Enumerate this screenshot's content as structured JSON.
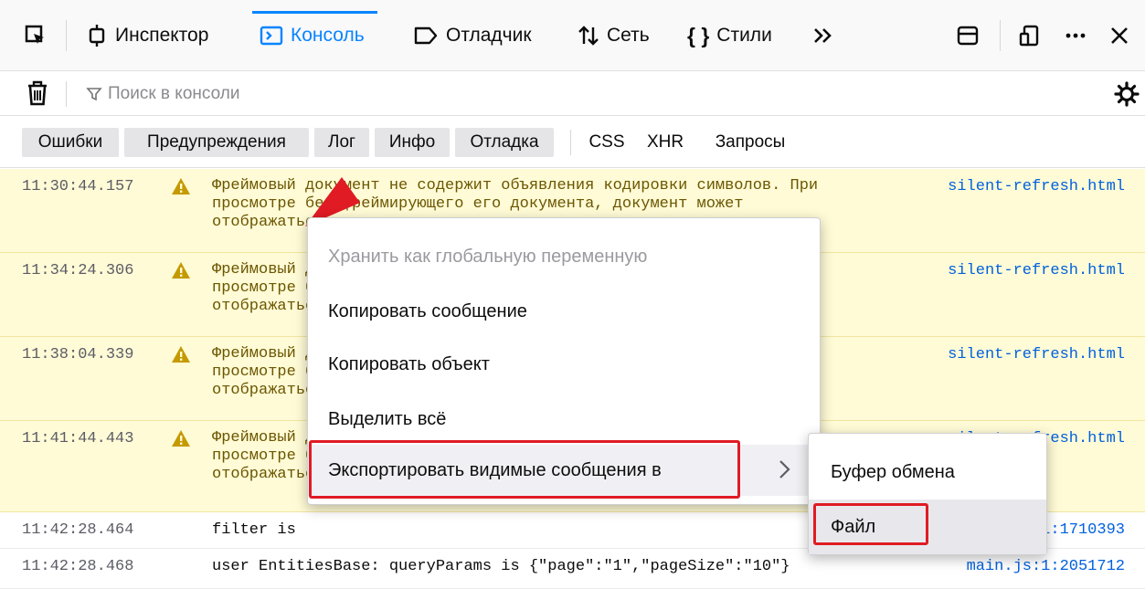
{
  "toolbar": {
    "tabs": [
      {
        "label": "Инспектор",
        "icon": "inspector-icon"
      },
      {
        "label": "Консоль",
        "icon": "console-icon",
        "active": true
      },
      {
        "label": "Отладчик",
        "icon": "debugger-icon"
      },
      {
        "label": "Сеть",
        "icon": "network-icon"
      },
      {
        "label": "Стили",
        "icon": "style-editor-icon"
      }
    ],
    "more_icon": "chevron-double-right-icon",
    "accent_color": "#0a84ff"
  },
  "filter": {
    "placeholder": "Поиск в консоли"
  },
  "levels": {
    "buttons": [
      "Ошибки",
      "Предупреждения",
      "Лог",
      "Инфо",
      "Отладка"
    ],
    "extra": [
      "CSS",
      "XHR",
      "Запросы"
    ]
  },
  "messages": [
    {
      "time": "11:30:44.157",
      "type": "warning",
      "line1": "Фреймовый документ не содержит объявления кодировки символов. При",
      "line2": "просмотре без фреймирующего его документа, документ может",
      "line3": "отображаться по-другому.",
      "source": "silent-refresh.html"
    },
    {
      "time": "11:34:24.306",
      "type": "warning",
      "line1": "Фреймовый документ не содержит объявления кодировки символов. При",
      "line2": "просмотре без фреймирующего его документа, документ может",
      "line3": "отображаться по-другому.",
      "source": "silent-refresh.html"
    },
    {
      "time": "11:38:04.339",
      "type": "warning",
      "line1": "Фреймовый документ не содержит объявления кодировки символов. При",
      "line2": "просмотре без фреймирующего его документа, документ может",
      "line3": "отображаться по-другому.",
      "source": "silent-refresh.html"
    },
    {
      "time": "11:41:44.443",
      "type": "warning",
      "line1": "Фреймовый документ не содержит объявления кодировки символов. При",
      "line2": "просмотре без фреймирующего его документа, документ может",
      "line3": "отображаться по-другому.",
      "source": "silent-refresh.html"
    },
    {
      "time": "11:42:28.464",
      "type": "log",
      "line1": "filter is",
      "source": "main.js:1:1710393"
    },
    {
      "time": "11:42:28.468",
      "type": "log",
      "line1": "user EntitiesBase: queryParams is {\"page\":\"1\",\"pageSize\":\"10\"}",
      "source": "main.js:1:2051712"
    }
  ],
  "context_menu": {
    "items": [
      {
        "label": "Хранить как глобальную переменную",
        "disabled": true
      },
      {
        "label": "Копировать сообщение"
      },
      {
        "label": "Копировать объект"
      },
      {
        "label": "Выделить всё"
      },
      {
        "label": "Экспортировать видимые сообщения в",
        "submenu": true
      }
    ]
  },
  "submenu": {
    "items": [
      "Буфер обмена",
      "Файл"
    ]
  },
  "highlight_color": "#e01b24",
  "warning_bg": "#fffbd6"
}
